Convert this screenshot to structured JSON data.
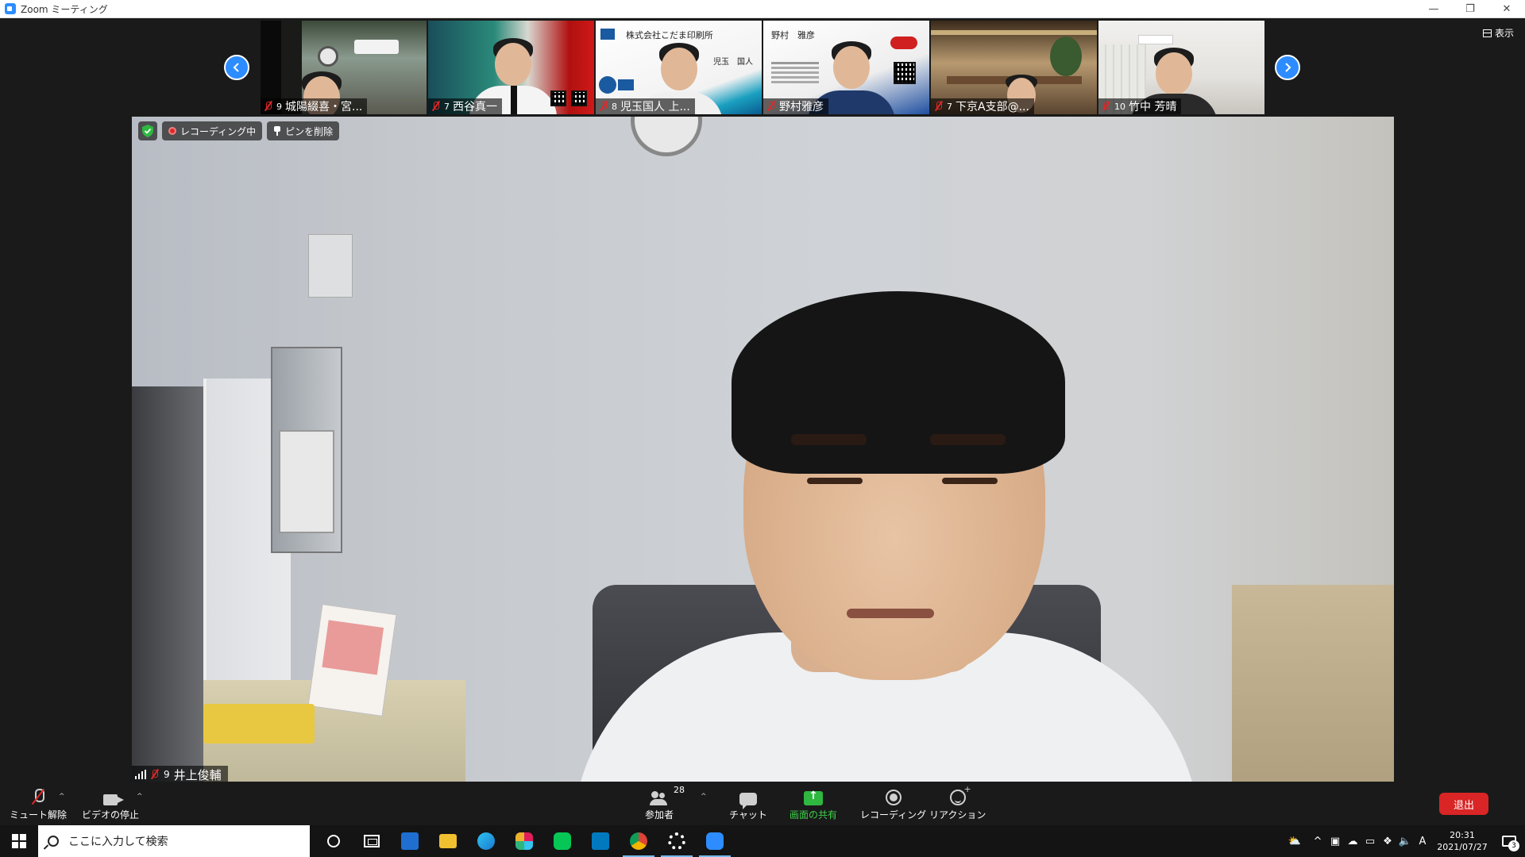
{
  "window": {
    "title": "Zoom ミーティング",
    "controls": [
      "—",
      "❐",
      "✕"
    ]
  },
  "view_button": {
    "label": "表示"
  },
  "thumbnails": [
    {
      "num": "9",
      "name": "城陽綴喜・宮..."
    },
    {
      "num": "7",
      "name": "西谷真一"
    },
    {
      "num": "8",
      "name": "児玉国人 上..."
    },
    {
      "num": "",
      "name": "野村雅彦"
    },
    {
      "num": "7",
      "name": "下京A支部@..."
    },
    {
      "num": "10",
      "name": "竹中 芳晴"
    }
  ],
  "thumb_cards": {
    "kodama_company": "株式会社こだま印刷所",
    "kodama_person": "児玉　国人",
    "nomura_person": "野村　雅彦"
  },
  "main_video": {
    "recording_label": "レコーディング中",
    "unpin_label": "ピンを削除",
    "speaker_num": "9",
    "speaker_name": "井上俊輔"
  },
  "toolbar": {
    "unmute": "ミュート解除",
    "stop_video": "ビデオの停止",
    "participants": "参加者",
    "participants_count": "28",
    "chat": "チャット",
    "share_screen": "画面の共有",
    "recording": "レコーディング",
    "reactions": "リアクション",
    "leave": "退出"
  },
  "taskbar": {
    "search_placeholder": "ここに入力して検索",
    "time": "20:31",
    "date": "2021/07/27",
    "ime": "A",
    "notification_count": "3"
  },
  "colors": {
    "zoom_blue": "#2d8cff",
    "share_green": "#2fb840",
    "leave_red": "#d92525",
    "muted_red": "#e02828"
  }
}
